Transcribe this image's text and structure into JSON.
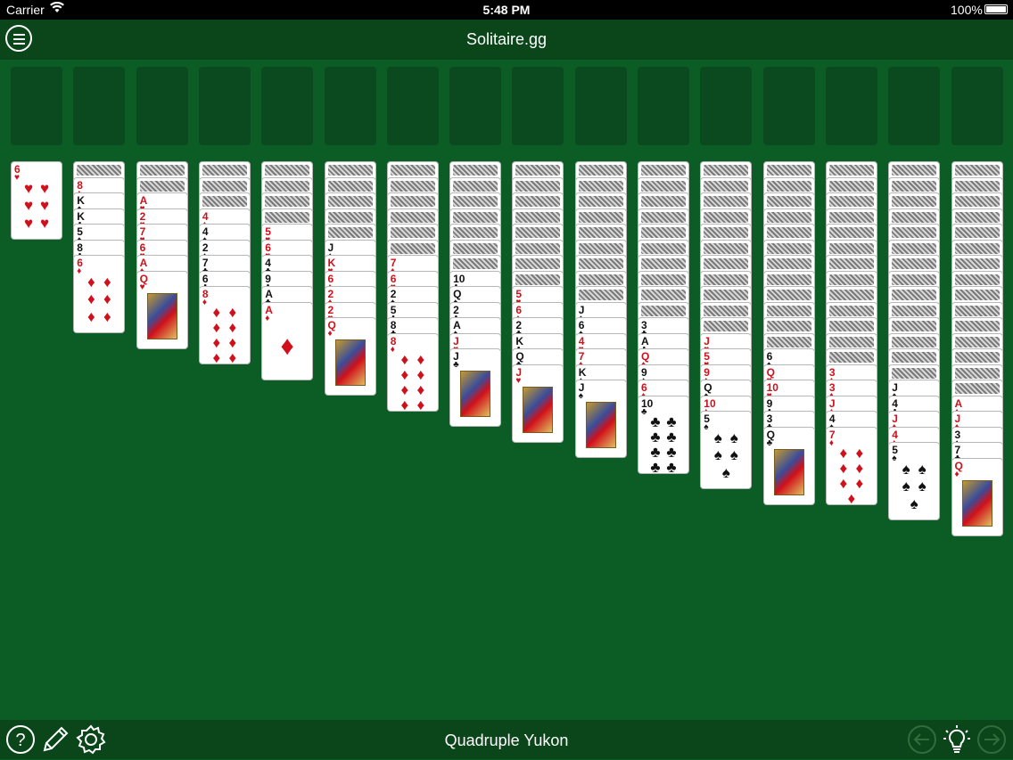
{
  "status_bar": {
    "carrier": "Carrier",
    "time": "5:48 PM",
    "battery": "100%"
  },
  "header": {
    "title": "Solitaire.gg",
    "menu_icon": "hamburger-menu-icon"
  },
  "footer": {
    "game_name": "Quadruple Yukon",
    "icons": [
      "help-icon",
      "pencil-icon",
      "settings-gear-icon",
      "undo-arrow-icon",
      "hint-lightbulb-icon",
      "redo-arrow-icon"
    ]
  },
  "colors": {
    "felt": "#0c5c26",
    "bar": "#0a4619",
    "red_suit": "#d0101a",
    "black_suit": "#111111"
  },
  "foundations_count": 16,
  "tableau": [
    {
      "backs": 0,
      "cards": [
        {
          "rank": "6",
          "suit": "♥"
        }
      ]
    },
    {
      "backs": 1,
      "cards": [
        {
          "rank": "8",
          "suit": "♦"
        },
        {
          "rank": "K",
          "suit": "♠"
        },
        {
          "rank": "K",
          "suit": "♣"
        },
        {
          "rank": "5",
          "suit": "♠"
        },
        {
          "rank": "8",
          "suit": "♣"
        },
        {
          "rank": "6",
          "suit": "♦"
        }
      ]
    },
    {
      "backs": 2,
      "cards": [
        {
          "rank": "A",
          "suit": "♥"
        },
        {
          "rank": "2",
          "suit": "♥"
        },
        {
          "rank": "7",
          "suit": "♥"
        },
        {
          "rank": "6",
          "suit": "♥"
        },
        {
          "rank": "A",
          "suit": "♦"
        },
        {
          "rank": "Q",
          "suit": "♥"
        }
      ]
    },
    {
      "backs": 3,
      "cards": [
        {
          "rank": "4",
          "suit": "♦"
        },
        {
          "rank": "4",
          "suit": "♠"
        },
        {
          "rank": "2",
          "suit": "♠"
        },
        {
          "rank": "7",
          "suit": "♣"
        },
        {
          "rank": "6",
          "suit": "♣"
        },
        {
          "rank": "8",
          "suit": "♦"
        }
      ]
    },
    {
      "backs": 4,
      "cards": [
        {
          "rank": "5",
          "suit": "♥"
        },
        {
          "rank": "6",
          "suit": "♥"
        },
        {
          "rank": "4",
          "suit": "♣"
        },
        {
          "rank": "9",
          "suit": "♣"
        },
        {
          "rank": "A",
          "suit": "♣"
        },
        {
          "rank": "A",
          "suit": "♦"
        }
      ]
    },
    {
      "backs": 5,
      "cards": [
        {
          "rank": "J",
          "suit": "♠"
        },
        {
          "rank": "K",
          "suit": "♥"
        },
        {
          "rank": "6",
          "suit": "♦"
        },
        {
          "rank": "2",
          "suit": "♦"
        },
        {
          "rank": "2",
          "suit": "♥"
        },
        {
          "rank": "Q",
          "suit": "♦"
        }
      ]
    },
    {
      "backs": 6,
      "cards": [
        {
          "rank": "7",
          "suit": "♦"
        },
        {
          "rank": "6",
          "suit": "♥"
        },
        {
          "rank": "2",
          "suit": "♠"
        },
        {
          "rank": "5",
          "suit": "♣"
        },
        {
          "rank": "8",
          "suit": "♣"
        },
        {
          "rank": "8",
          "suit": "♦"
        }
      ]
    },
    {
      "backs": 7,
      "cards": [
        {
          "rank": "10",
          "suit": "♣"
        },
        {
          "rank": "Q",
          "suit": "♠"
        },
        {
          "rank": "2",
          "suit": "♣"
        },
        {
          "rank": "A",
          "suit": "♠"
        },
        {
          "rank": "J",
          "suit": "♥"
        },
        {
          "rank": "J",
          "suit": "♣"
        }
      ]
    },
    {
      "backs": 8,
      "cards": [
        {
          "rank": "5",
          "suit": "♥"
        },
        {
          "rank": "6",
          "suit": "♦"
        },
        {
          "rank": "2",
          "suit": "♣"
        },
        {
          "rank": "K",
          "suit": "♣"
        },
        {
          "rank": "Q",
          "suit": "♣"
        },
        {
          "rank": "J",
          "suit": "♥"
        }
      ]
    },
    {
      "backs": 9,
      "cards": [
        {
          "rank": "J",
          "suit": "♠"
        },
        {
          "rank": "6",
          "suit": "♠"
        },
        {
          "rank": "4",
          "suit": "♥"
        },
        {
          "rank": "7",
          "suit": "♦"
        },
        {
          "rank": "K",
          "suit": "♠"
        },
        {
          "rank": "J",
          "suit": "♠"
        }
      ]
    },
    {
      "backs": 10,
      "cards": [
        {
          "rank": "3",
          "suit": "♣"
        },
        {
          "rank": "A",
          "suit": "♣"
        },
        {
          "rank": "Q",
          "suit": "♦"
        },
        {
          "rank": "9",
          "suit": "♠"
        },
        {
          "rank": "6",
          "suit": "♦"
        },
        {
          "rank": "10",
          "suit": "♣"
        }
      ]
    },
    {
      "backs": 11,
      "cards": [
        {
          "rank": "J",
          "suit": "♥"
        },
        {
          "rank": "5",
          "suit": "♥"
        },
        {
          "rank": "9",
          "suit": "♦"
        },
        {
          "rank": "Q",
          "suit": "♠"
        },
        {
          "rank": "10",
          "suit": "♦"
        },
        {
          "rank": "5",
          "suit": "♠"
        }
      ]
    },
    {
      "backs": 12,
      "cards": [
        {
          "rank": "6",
          "suit": "♠"
        },
        {
          "rank": "Q",
          "suit": "♥"
        },
        {
          "rank": "10",
          "suit": "♥"
        },
        {
          "rank": "9",
          "suit": "♣"
        },
        {
          "rank": "3",
          "suit": "♣"
        },
        {
          "rank": "Q",
          "suit": "♣"
        }
      ]
    },
    {
      "backs": 13,
      "cards": [
        {
          "rank": "3",
          "suit": "♦"
        },
        {
          "rank": "3",
          "suit": "♦"
        },
        {
          "rank": "J",
          "suit": "♦"
        },
        {
          "rank": "4",
          "suit": "♠"
        },
        {
          "rank": "7",
          "suit": "♦"
        }
      ]
    },
    {
      "backs": 14,
      "cards": [
        {
          "rank": "J",
          "suit": "♠"
        },
        {
          "rank": "4",
          "suit": "♣"
        },
        {
          "rank": "J",
          "suit": "♦"
        },
        {
          "rank": "4",
          "suit": "♦"
        },
        {
          "rank": "5",
          "suit": "♠"
        }
      ]
    },
    {
      "backs": 15,
      "cards": [
        {
          "rank": "A",
          "suit": "♦"
        },
        {
          "rank": "J",
          "suit": "♦"
        },
        {
          "rank": "3",
          "suit": "♠"
        },
        {
          "rank": "7",
          "suit": "♣"
        },
        {
          "rank": "Q",
          "suit": "♦"
        }
      ]
    }
  ]
}
